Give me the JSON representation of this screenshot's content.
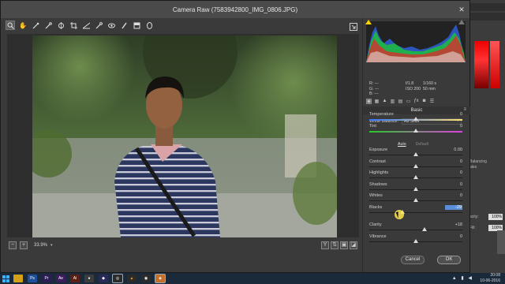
{
  "window": {
    "title": "Camera Raw (7583942800_IMG_0806.JPG)"
  },
  "toolbar": {
    "tools": [
      "zoom-tool",
      "hand-tool",
      "white-balance-tool",
      "color-sampler-tool",
      "targeted-adjustment-tool",
      "crop-tool",
      "straighten-tool",
      "spot-removal-tool",
      "red-eye-tool",
      "adjustment-brush",
      "graduated-filter",
      "radial-filter",
      "rotate-tool"
    ]
  },
  "status": {
    "zoom": "33.9%"
  },
  "histogram": {
    "camera_info": {
      "r": "R:",
      "g": "G:",
      "b": "B:",
      "r_val": "---",
      "g_val": "---",
      "b_val": "---",
      "aperture": "f/1.8",
      "shutter": "1/160 s",
      "iso": "ISO 200",
      "focal": "50 mm"
    }
  },
  "panel": {
    "section_title": "Basic",
    "white_balance": {
      "label": "White Balance:",
      "value": "As Shot"
    },
    "auto_label": "Auto",
    "default_label": "Default",
    "sliders": {
      "temperature": {
        "label": "Temperature",
        "value": "0",
        "position": 0.5
      },
      "tint": {
        "label": "Tint",
        "value": "0",
        "position": 0.5
      },
      "exposure": {
        "label": "Exposure",
        "value": "0.00",
        "position": 0.5
      },
      "contrast": {
        "label": "Contrast",
        "value": "0",
        "position": 0.5
      },
      "highlights": {
        "label": "Highlights",
        "value": "0",
        "position": 0.5
      },
      "shadows": {
        "label": "Shadows",
        "value": "0",
        "position": 0.5
      },
      "whites": {
        "label": "Whites",
        "value": "0",
        "position": 0.5
      },
      "blacks": {
        "label": "Blacks",
        "value": "-29",
        "position": 0.36
      },
      "clarity": {
        "label": "Clarity",
        "value": "+18",
        "position": 0.59
      },
      "vibrance": {
        "label": "Vibrance",
        "value": "0",
        "position": 0.5
      }
    }
  },
  "buttons": {
    "cancel": "Cancel",
    "ok": "OK"
  },
  "ps_panel": {
    "opacity_label": "acity:",
    "opacity_value": "100%",
    "fill_label": "Fill:",
    "fill_value": "100%",
    "side_text": "Balancing",
    "side_text2": "ales"
  },
  "taskbar": {
    "time": "20:08",
    "date": "10-06-2016"
  },
  "colors": {
    "accent": "#5a8ed8",
    "dialog_bg": "#3a3a3a",
    "taskbar_bg": "#1b2a3a"
  }
}
